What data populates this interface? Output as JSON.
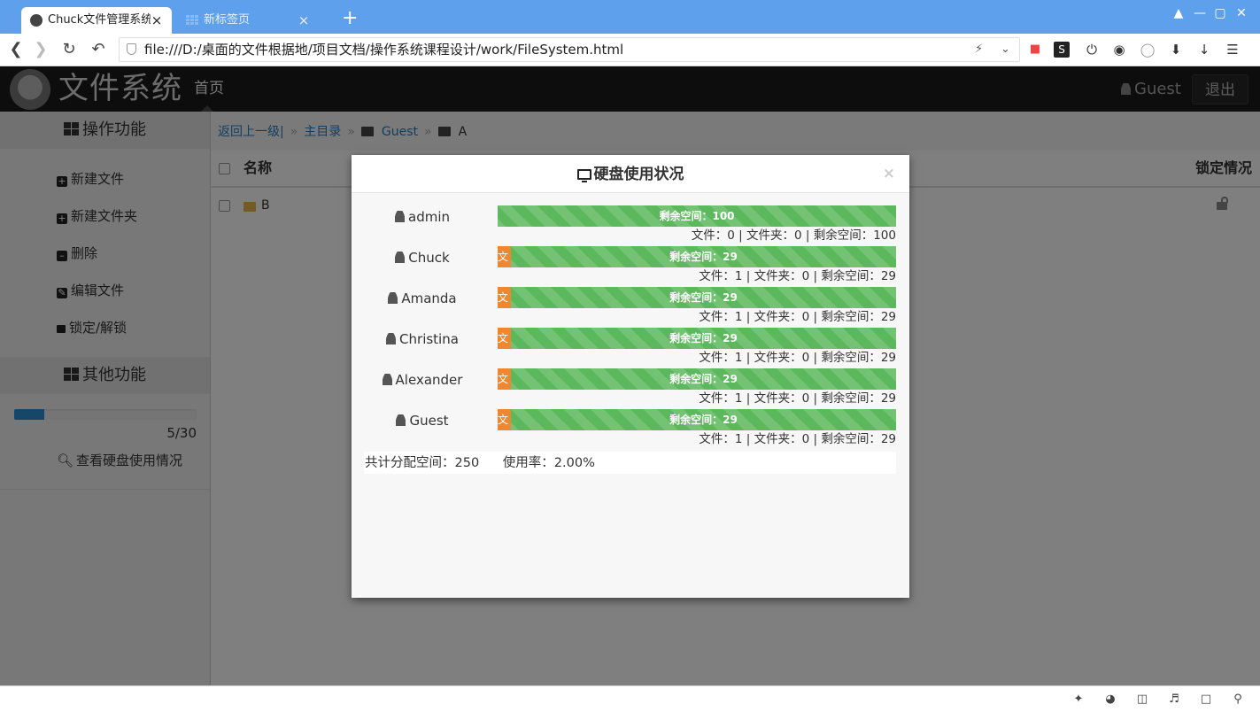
{
  "browser": {
    "tabs": [
      {
        "title": "Chuck文件管理系统",
        "active": true
      },
      {
        "title": "新标签页",
        "active": false
      }
    ],
    "url": "file:///D:/桌面的文件根据地/项目文档/操作系统课程设计/work/FileSystem.html",
    "new_tab_icon": "plus-icon"
  },
  "app": {
    "logo_text": "文件系统",
    "nav_home": "首页",
    "user_name": "Guest",
    "logout_label": "退出"
  },
  "sidebar": {
    "section_ops": "操作功能",
    "items": [
      {
        "label": "新建文件",
        "icon": "plus-square-icon"
      },
      {
        "label": "新建文件夹",
        "icon": "plus-square-icon"
      },
      {
        "label": "删除",
        "icon": "minus-square-icon"
      },
      {
        "label": "编辑文件",
        "icon": "edit-icon"
      },
      {
        "label": "锁定/解锁",
        "icon": "lock-icon"
      }
    ],
    "section_other": "其他功能",
    "disk_usage": {
      "used": 5,
      "total": 30,
      "text": "5/30",
      "fraction": 0.1667
    },
    "view_disk_label": "查看硬盘使用情况"
  },
  "breadcrumb": {
    "back_label": "返回上一级|",
    "home_label": "主目录",
    "sep": "»",
    "path": [
      "Guest",
      "A"
    ]
  },
  "table": {
    "col_name": "名称",
    "col_lock": "锁定情况",
    "rows": [
      {
        "name": "B",
        "type": "folder",
        "locked": false
      }
    ]
  },
  "modal": {
    "title": "硬盘使用状况",
    "close": "×",
    "users": [
      {
        "name": "admin",
        "used_label": "",
        "used_fraction": 0,
        "free_label": "剩余空间：100",
        "stats": "文件：0 | 文件夹：0 | 剩余空间：100"
      },
      {
        "name": "Chuck",
        "used_label": "文",
        "used_fraction": 0.0333,
        "free_label": "剩余空间：29",
        "stats": "文件：1 | 文件夹：0 | 剩余空间：29"
      },
      {
        "name": "Amanda",
        "used_label": "文",
        "used_fraction": 0.0333,
        "free_label": "剩余空间：29",
        "stats": "文件：1 | 文件夹：0 | 剩余空间：29"
      },
      {
        "name": "Christina",
        "used_label": "文",
        "used_fraction": 0.0333,
        "free_label": "剩余空间：29",
        "stats": "文件：1 | 文件夹：0 | 剩余空间：29"
      },
      {
        "name": "Alexander",
        "used_label": "文",
        "used_fraction": 0.0333,
        "free_label": "剩余空间：29",
        "stats": "文件：1 | 文件夹：0 | 剩余空间：29"
      },
      {
        "name": "Guest",
        "used_label": "文",
        "used_fraction": 0.0333,
        "free_label": "剩余空间：29",
        "stats": "文件：1 | 文件夹：0 | 剩余空间：29"
      }
    ],
    "summary_total": "共计分配空间：250",
    "summary_rate": "使用率：2.00%"
  },
  "colors": {
    "used": "#f0872e",
    "free": "#5cb85c",
    "disk_fill": "#2d8fd2",
    "tabbar": "#5ea0ec",
    "app_header": "#1a1a1a"
  }
}
